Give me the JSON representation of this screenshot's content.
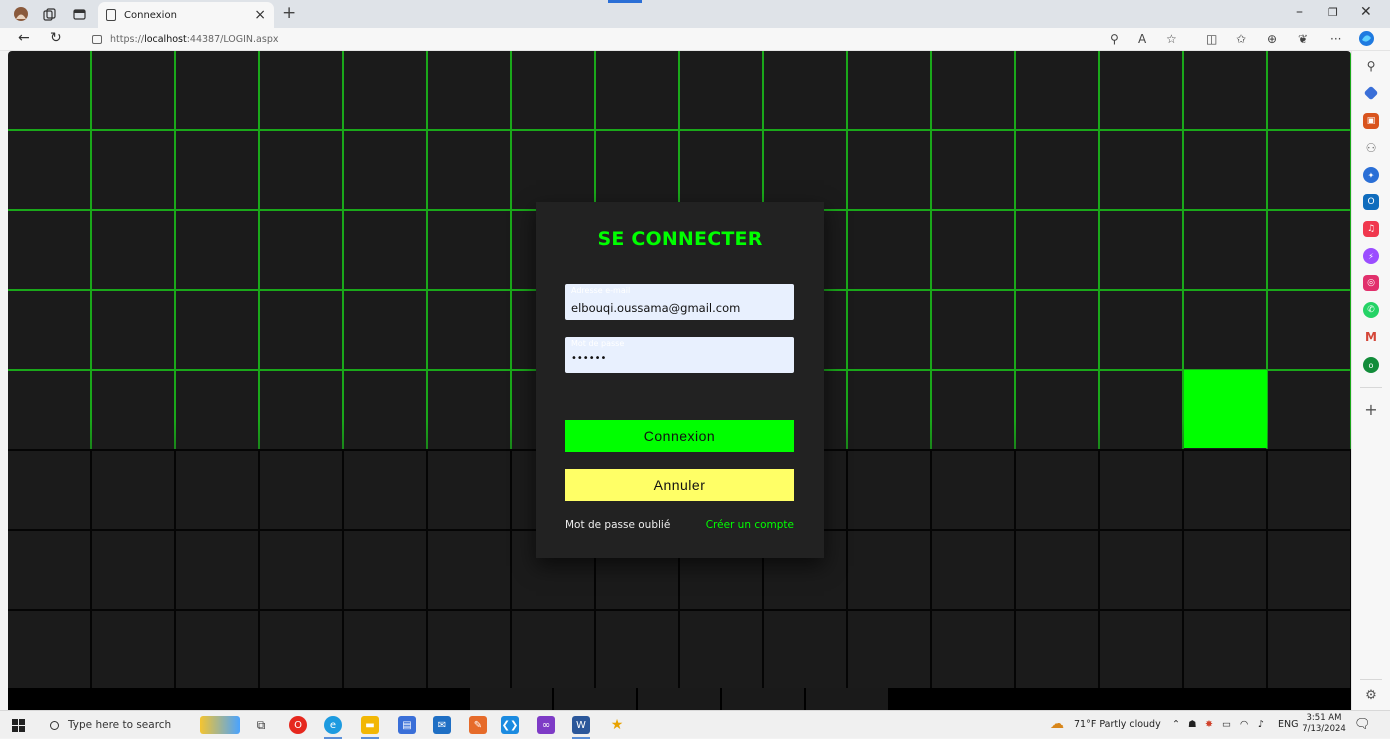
{
  "browser": {
    "tab_title": "Connexion",
    "url_prefix": "https://",
    "url_host": "localhost",
    "url_rest": ":44387/LOGIN.aspx"
  },
  "login": {
    "title": "SE CONNECTER",
    "email_label": "Adresse e-mail",
    "email_value": "elbouqi.oussama@gmail.com",
    "password_label": "Mot de passe",
    "password_value": "••••••",
    "connect_button": "Connexion",
    "cancel_button": "Annuler",
    "forgot_link": "Mot de passe oublié",
    "create_link": "Créer un compte"
  },
  "taskbar": {
    "search_placeholder": "Type here to search",
    "weather": "71°F  Partly cloudy",
    "language": "ENG",
    "time": "3:51 AM",
    "date": "7/13/2024"
  },
  "colors": {
    "accent_green": "#00ff00",
    "cancel_yellow": "#ffff66",
    "page_bg": "#1b1b1b"
  }
}
